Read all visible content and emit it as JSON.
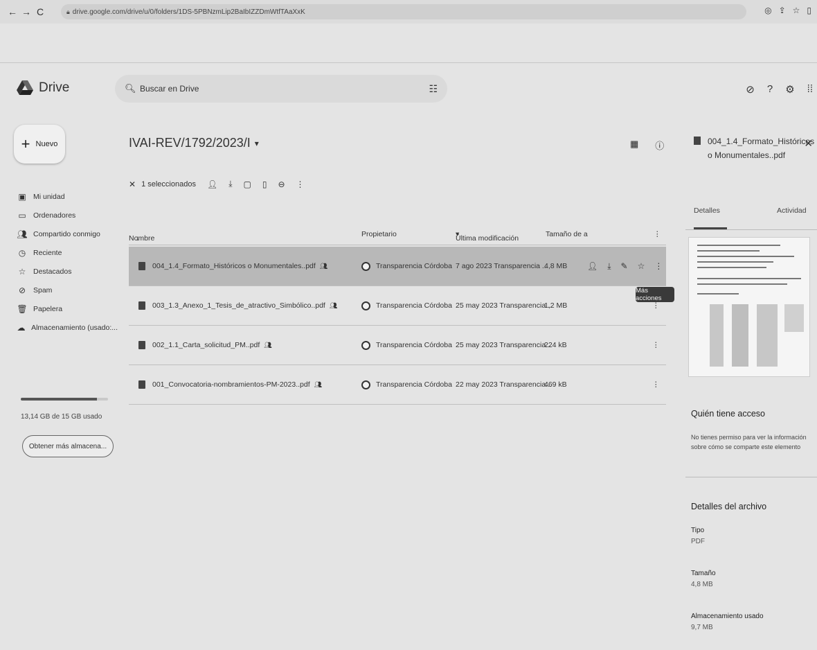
{
  "browser": {
    "url": "drive.google.com/drive/u/0/folders/1DS-5PBNzmLip2BaIbIZZDmWtfTAaXxK"
  },
  "app": {
    "name": "Drive",
    "search_placeholder": "Buscar en Drive"
  },
  "sidebar": {
    "new_label": "Nuevo",
    "items": [
      {
        "label": "Mi unidad",
        "icon": "drive-icon"
      },
      {
        "label": "Ordenadores",
        "icon": "computer-icon"
      },
      {
        "label": "Compartido conmigo",
        "icon": "people-icon"
      },
      {
        "label": "Reciente",
        "icon": "clock-icon"
      },
      {
        "label": "Destacados",
        "icon": "star-icon"
      },
      {
        "label": "Spam",
        "icon": "spam-icon"
      },
      {
        "label": "Papelera",
        "icon": "trash-icon"
      },
      {
        "label": "Almacenamiento (usado:...",
        "icon": "cloud-icon"
      }
    ],
    "storage_text": "13,14 GB de 15 GB usado",
    "storage_fraction": 0.876,
    "more_storage_label": "Obtener más almacena..."
  },
  "main": {
    "folder_title": "IVAI-REV/1792/2023/I",
    "selection_text": "1 seleccionados",
    "columns": {
      "name": "Nombre",
      "owner": "Propietario",
      "modified": "Última modificación",
      "size": "Tamaño de a"
    },
    "rows": [
      {
        "name": "004_1.4_Formato_Históricos o Monumentales..pdf",
        "owner": "Transparencia Córdoba",
        "modified": "7 ago 2023 Transparencia ...",
        "size": "4,8 MB",
        "selected": true
      },
      {
        "name": "003_1.3_Anexo_1_Tesis_de_atractivo_Simbólico..pdf",
        "owner": "Transparencia Córdoba",
        "modified": "25 may 2023 Transparencia...",
        "size": "1,2 MB",
        "selected": false
      },
      {
        "name": "002_1.1_Carta_solicitud_PM..pdf",
        "owner": "Transparencia Córdoba",
        "modified": "25 may 2023 Transparencia...",
        "size": "224 kB",
        "selected": false
      },
      {
        "name": "001_Convocatoria-nombramientos-PM-2023..pdf",
        "owner": "Transparencia Córdoba",
        "modified": "22 may 2023 Transparencia...",
        "size": "469 kB",
        "selected": false
      }
    ],
    "tooltip": "Más acciones"
  },
  "panel": {
    "file_name": "004_1.4_Formato_Históricos o Monumentales..pdf",
    "tab_details": "Detalles",
    "tab_activity": "Actividad",
    "access_heading": "Quién tiene acceso",
    "access_text": "No tienes permiso para ver la información sobre cómo se comparte este elemento",
    "file_details_heading": "Detalles del archivo",
    "type_label": "Tipo",
    "type_value": "PDF",
    "size_label": "Tamaño",
    "size_value": "4,8 MB",
    "storage_label": "Almacenamiento usado",
    "storage_value": "9,7 MB"
  }
}
